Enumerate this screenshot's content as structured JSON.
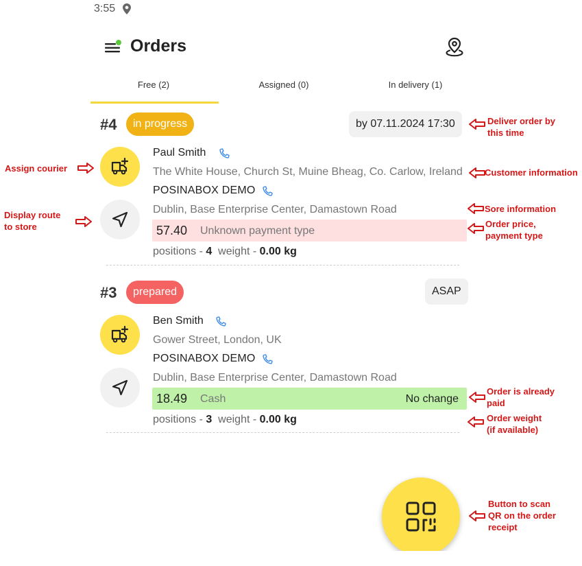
{
  "status": {
    "time": "3:55"
  },
  "header": {
    "title": "Orders"
  },
  "tabs": [
    {
      "label": "Free (2)"
    },
    {
      "label": "Assigned (0)"
    },
    {
      "label": "In delivery (1)"
    }
  ],
  "orders": [
    {
      "number": "#4",
      "status": "in progress",
      "deliver_by": "by 07.11.2024 17:30",
      "customer": "Paul Smith",
      "customer_address": "The White House, Church St, Muine Bheag, Co. Carlow, Ireland",
      "store": "POSINABOX DEMO",
      "store_address": "Dublin, Base Enterprise Center, Damastown Road",
      "price": "57.40",
      "payment_type": "Unknown payment type",
      "payment_extra": "",
      "positions_label": "positions - ",
      "positions": "4",
      "weight_label": "weight - ",
      "weight": "0.00 kg"
    },
    {
      "number": "#3",
      "status": "prepared",
      "deliver_by": "ASAP",
      "customer": "Ben Smith",
      "customer_address": "Gower Street, London, UK",
      "store": "POSINABOX DEMO",
      "store_address": "Dublin, Base Enterprise Center, Damastown Road",
      "price": "18.49",
      "payment_type": "Cash",
      "payment_extra": "No change",
      "positions_label": "positions - ",
      "positions": "3",
      "weight_label": "weight - ",
      "weight": "0.00 kg"
    }
  ],
  "annotations": {
    "assign_courier": "Assign courier",
    "display_route_1": "Display route",
    "display_route_2": "to store",
    "deliver_by_1": "Deliver order by",
    "deliver_by_2": "this time",
    "customer_info": "Customer information",
    "store_info": "Sore information",
    "order_price_1": "Order price,",
    "order_price_2": "payment type",
    "paid_1": "Order is already",
    "paid_2": "paid",
    "weight_1": "Order weight",
    "weight_2": "(if available)",
    "scan_1": "Button to scan",
    "scan_2": "QR on the order",
    "scan_3": "receipt"
  },
  "colors": {
    "accent": "#fde04a",
    "in_progress": "#f0b215",
    "prepared": "#f46262",
    "unpaid_row": "#fde0df",
    "paid_row": "#bff2a8",
    "phone": "#3d8be8",
    "annotation": "#d41717"
  },
  "icons": {
    "menu": "menu-icon",
    "map": "map-pin-icon",
    "assign": "truck-plus-icon",
    "route": "navigation-arrow-icon",
    "phone": "phone-icon",
    "scan": "qr-code-icon"
  }
}
